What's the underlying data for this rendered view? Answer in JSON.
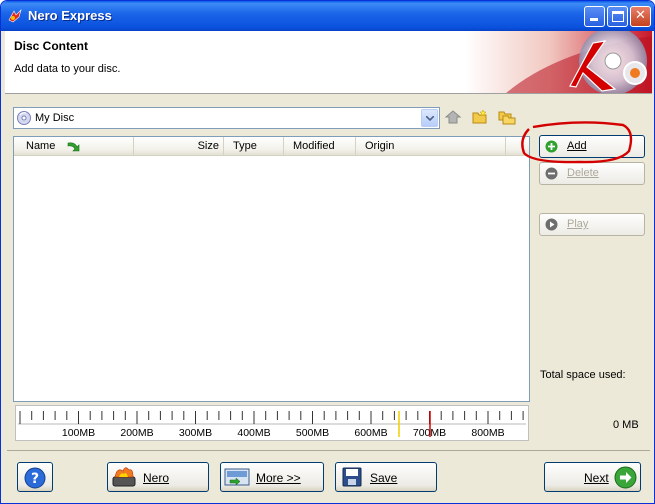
{
  "window": {
    "title": "Nero Express"
  },
  "header": {
    "title": "Disc Content",
    "subtitle": "Add data to your disc."
  },
  "disc_selector": {
    "value": "My Disc"
  },
  "file_list": {
    "columns": [
      "Name",
      "Size",
      "Type",
      "Modified",
      "Origin"
    ],
    "rows": []
  },
  "side_buttons": {
    "add": "Add",
    "delete": "Delete",
    "play": "Play"
  },
  "space": {
    "label": "Total space used:",
    "value": "0 MB"
  },
  "ruler": {
    "labels": [
      "100MB",
      "200MB",
      "300MB",
      "400MB",
      "500MB",
      "600MB",
      "700MB",
      "800MB"
    ]
  },
  "bottom_buttons": {
    "nero": "Nero",
    "more": "More >>",
    "save": "Save",
    "next": "Next"
  },
  "colors": {
    "title_bar": "#0a51dd",
    "accent_red": "#d40000",
    "add_icon": "#2ea12e"
  }
}
